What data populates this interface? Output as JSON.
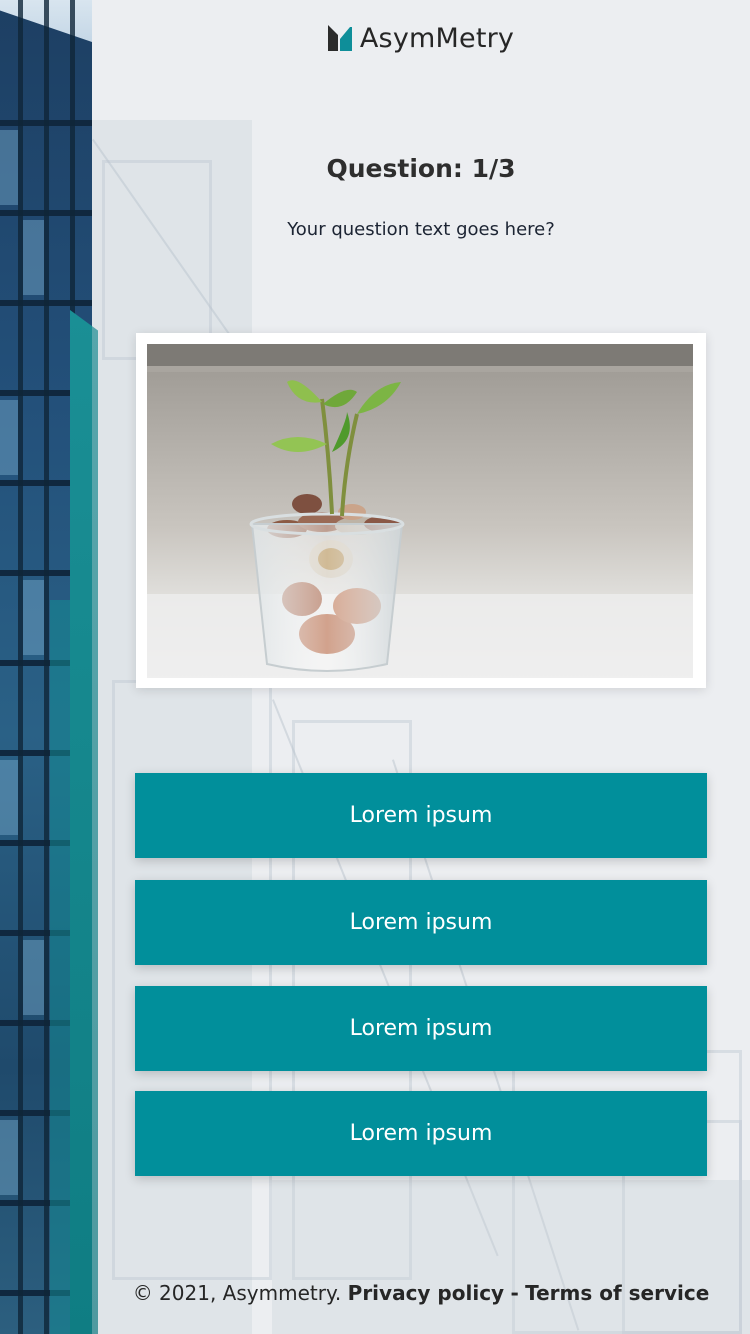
{
  "brand": {
    "name": "AsymMetry",
    "logo_icon": "asymmetry-logo-icon",
    "logo_colors": [
      "#2b2b2b",
      "#0e8e99"
    ]
  },
  "quiz": {
    "title": "Question: 1/3",
    "question": "Your question text goes here?",
    "image_icon": "plant-in-coin-jar-photo",
    "answers": [
      {
        "label": "Lorem ipsum"
      },
      {
        "label": "Lorem ipsum"
      },
      {
        "label": "Lorem ipsum"
      },
      {
        "label": "Lorem ipsum"
      }
    ]
  },
  "footer": {
    "copyright": "© 2021, Asymmetry.",
    "privacy": "Privacy policy",
    "separator": "-",
    "terms": "Terms of service"
  },
  "colors": {
    "accent": "#018f9b",
    "background": "#eceef1",
    "text": "#2b2b2b"
  }
}
